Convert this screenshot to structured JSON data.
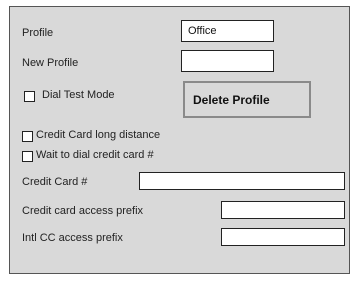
{
  "profile": {
    "label": "Profile",
    "value": "Office"
  },
  "new_profile": {
    "label": "New Profile",
    "value": ""
  },
  "dial_test_mode": {
    "label": "Dial Test Mode",
    "checked": false
  },
  "delete_profile_button": "Delete Profile",
  "credit_card_long_distance": {
    "label": "Credit Card long distance",
    "checked": false
  },
  "wait_to_dial": {
    "label": "Wait to dial credit card #",
    "checked": false
  },
  "credit_card_number": {
    "label": "Credit Card #",
    "value": ""
  },
  "credit_card_access_prefix": {
    "label": "Credit card access prefix",
    "value": ""
  },
  "intl_cc_access_prefix": {
    "label": "Intl CC access prefix",
    "value": ""
  }
}
